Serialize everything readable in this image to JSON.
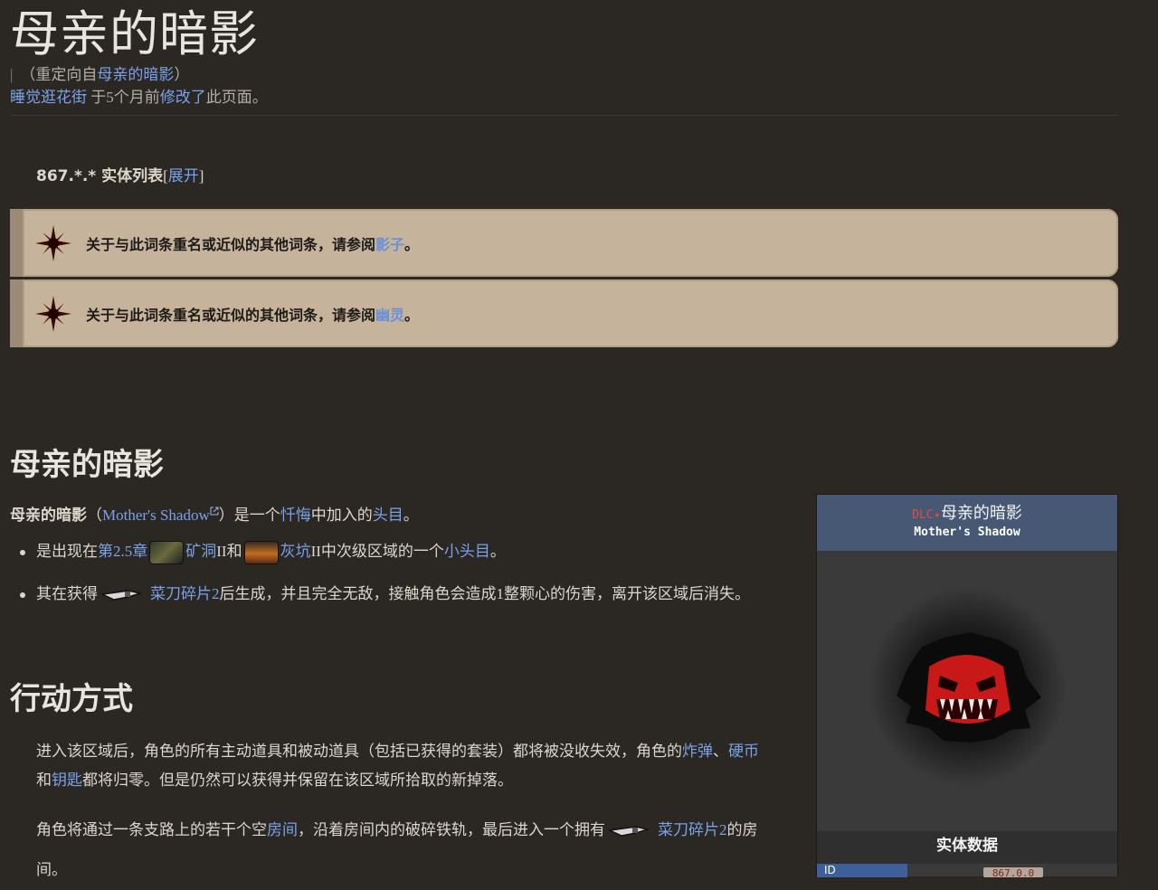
{
  "page": {
    "title": "母亲的暗影",
    "redirect_prefix": "（重定向自",
    "redirect_link": "母亲的暗影",
    "redirect_suffix": "）",
    "editor": "睡觉逛花街",
    "edited_mid": " 于5个月前",
    "edited_link": "修改了",
    "edited_suffix": "此页面。"
  },
  "entity_list": {
    "prefix": "867.*.* ",
    "label": "实体列表",
    "open_bracket": "[",
    "toggle": "展开",
    "close_bracket": "]"
  },
  "notices": [
    {
      "text": "关于与此词条重名或近似的其他词条，请参阅",
      "link": "影子",
      "end": "。"
    },
    {
      "text": "关于与此词条重名或近似的其他词条，请参阅",
      "link": "幽灵",
      "end": "。"
    }
  ],
  "section1": {
    "heading": "母亲的暗影",
    "intro_bold": "母亲的暗影",
    "intro_open": "（",
    "intro_ext": "Mother's Shadow",
    "intro_mid": "）是一个",
    "intro_link1": "忏悔",
    "intro_mid2": "中加入的",
    "intro_link2": "头目",
    "intro_end": "。",
    "b1_pre": "是出现在",
    "b1_link1": "第2.5章",
    "b1_link2": "矿洞",
    "b1_mid": "II和",
    "b1_link3": "灰坑",
    "b1_mid2": "II中次级区域的一个",
    "b1_link4": "小头目",
    "b1_end": "。",
    "b2_pre": "其在获得",
    "b2_link": "菜刀碎片2",
    "b2_end": "后生成，并且完全无敌，接触角色会造成1整颗心的伤害，离开该区域后消失。"
  },
  "section2": {
    "heading": "行动方式",
    "p1_a": "进入该区域后，角色的所有主动道具和被动道具（包括已获得的套装）都将被没收失效，角色的",
    "p1_link1": "炸弹",
    "p1_sep": "、",
    "p1_link2": "硬币",
    "p1_b": "和",
    "p1_link3": "钥匙",
    "p1_c": "都将归零。但是仍然可以获得并保留在该区域所拾取的新掉落。",
    "p2_a": "角色将通过一条支路上的若干个空",
    "p2_link1": "房间",
    "p2_b": "，沿着房间内的破碎铁轨，最后进入一个拥有",
    "p2_link2": "菜刀碎片2",
    "p2_c": "的房",
    "p2_d": "间。"
  },
  "infobox": {
    "dlc_tag": "DLC",
    "title": "母亲的暗影",
    "subtitle": "Mother's Shadow",
    "section": "实体数据",
    "id_label": "ID",
    "id_value": "867.0.0"
  },
  "colors": {
    "link": "#7aa2e8",
    "notice_bg": "#c6b39b",
    "infobox_header": "#465874",
    "background": "#2b2723"
  }
}
